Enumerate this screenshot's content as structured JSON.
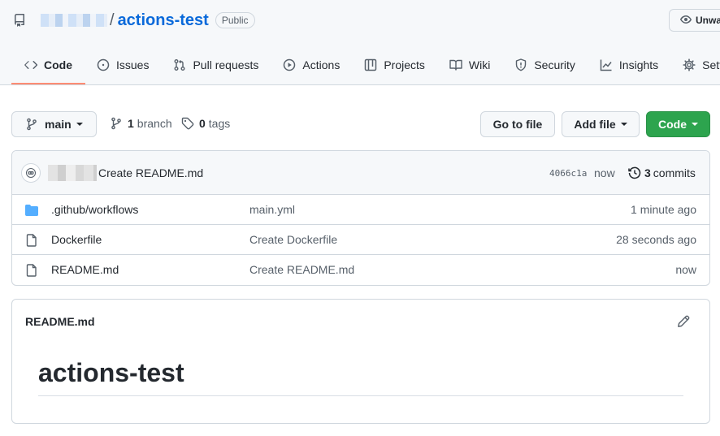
{
  "repo": {
    "name": "actions-test",
    "visibility": "Public",
    "watch_label": "Unwa"
  },
  "tabs": [
    {
      "label": "Code",
      "icon": "code-icon"
    },
    {
      "label": "Issues",
      "icon": "issue-icon"
    },
    {
      "label": "Pull requests",
      "icon": "pull-request-icon"
    },
    {
      "label": "Actions",
      "icon": "play-icon"
    },
    {
      "label": "Projects",
      "icon": "table-icon"
    },
    {
      "label": "Wiki",
      "icon": "book-icon"
    },
    {
      "label": "Security",
      "icon": "shield-icon"
    },
    {
      "label": "Insights",
      "icon": "graph-icon"
    },
    {
      "label": "Sett",
      "icon": "gear-icon"
    }
  ],
  "toolbar": {
    "branch": "main",
    "branch_count": "1",
    "branch_label": "branch",
    "tag_count": "0",
    "tag_label": "tags",
    "go_to_file": "Go to file",
    "add_file": "Add file",
    "code": "Code"
  },
  "latest_commit": {
    "message": "Create README.md",
    "sha": "4066c1a",
    "when": "now",
    "count": "3",
    "count_label": "commits"
  },
  "files": [
    {
      "type": "folder",
      "name": ".github/workflows",
      "message": "main.yml",
      "age": "1 minute ago"
    },
    {
      "type": "file",
      "name": "Dockerfile",
      "message": "Create Dockerfile",
      "age": "28 seconds ago"
    },
    {
      "type": "file",
      "name": "README.md",
      "message": "Create README.md",
      "age": "now"
    }
  ],
  "readme": {
    "filename": "README.md",
    "heading": "actions-test"
  },
  "colors": {
    "accent": "#0969da",
    "primary_button": "#2da44e",
    "active_tab_underline": "#fd8c73",
    "folder": "#54aeff"
  }
}
